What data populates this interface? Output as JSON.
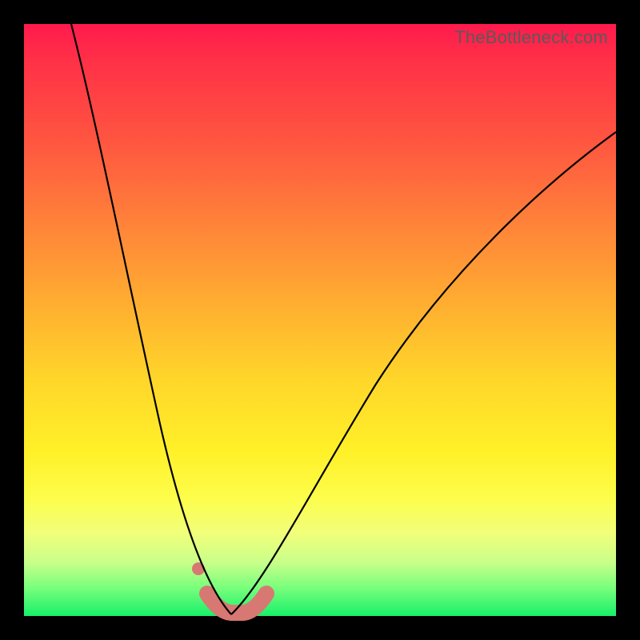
{
  "watermark": "TheBottleneck.com",
  "colors": {
    "frame": "#000000",
    "curve_thin": "#000000",
    "highlight": "#d77873",
    "gradient_stops": [
      "#ff1a4d",
      "#ff3047",
      "#ff5640",
      "#ff8a38",
      "#ffb030",
      "#ffd62a",
      "#fff028",
      "#fdfd4a",
      "#f1ff7a",
      "#c8ff8a",
      "#7dff7d",
      "#18f06a"
    ]
  },
  "chart_data": {
    "type": "line",
    "title": "",
    "xlabel": "",
    "ylabel": "",
    "xlim": [
      0,
      100
    ],
    "ylim": [
      0,
      100
    ],
    "series": [
      {
        "name": "left-branch",
        "x": [
          8,
          12,
          16,
          20,
          24,
          27,
          30,
          32,
          33.5,
          35
        ],
        "values": [
          100,
          82,
          63,
          44,
          27,
          15,
          6,
          2,
          0.5,
          0
        ]
      },
      {
        "name": "right-branch",
        "x": [
          35,
          37,
          40,
          45,
          52,
          60,
          70,
          82,
          95,
          100
        ],
        "values": [
          0,
          0.5,
          3,
          10,
          22,
          36,
          52,
          66,
          78,
          82
        ]
      },
      {
        "name": "highlight-band",
        "x": [
          31,
          33,
          35,
          37,
          39
        ],
        "values": [
          3,
          0.5,
          0,
          0.5,
          3
        ]
      }
    ],
    "annotations": [
      {
        "name": "marker-dot",
        "x": 29.5,
        "y": 8
      }
    ]
  }
}
